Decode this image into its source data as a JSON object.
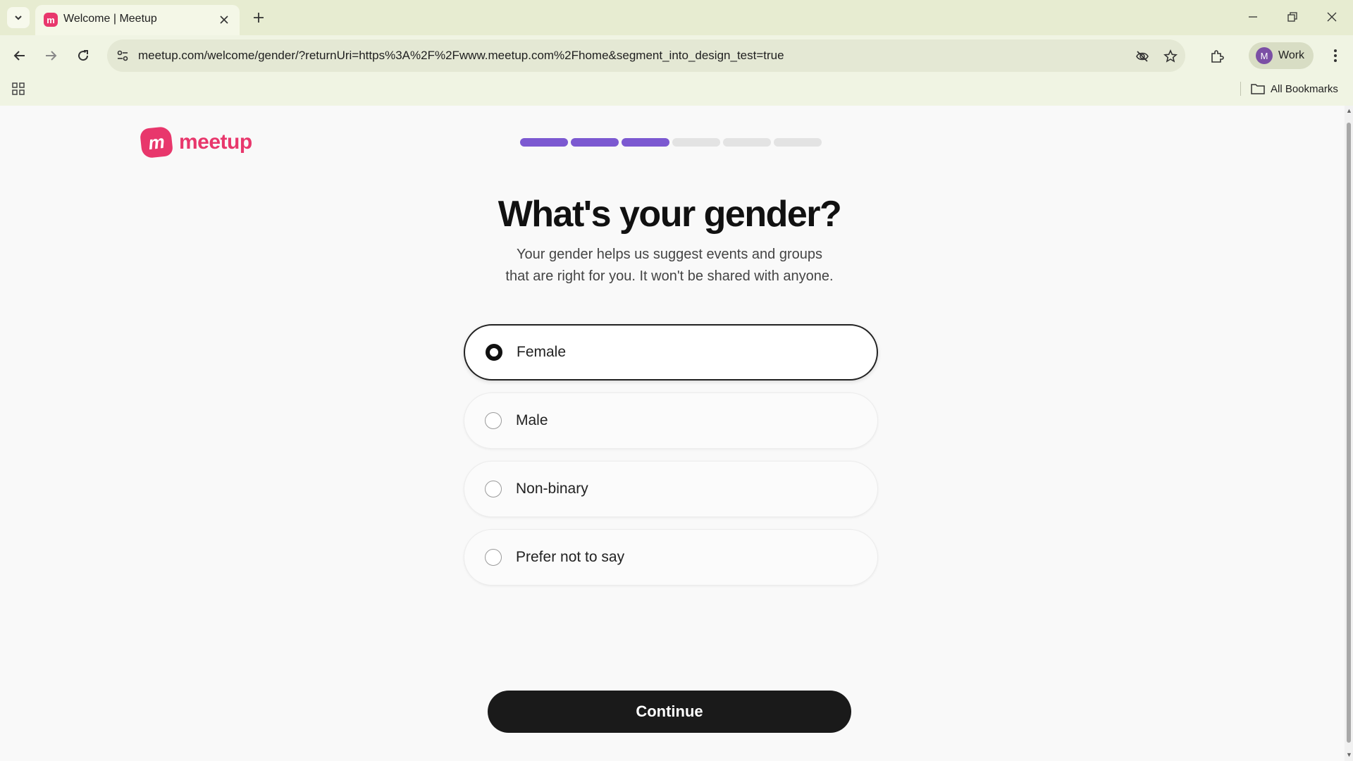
{
  "browser": {
    "tab_title": "Welcome | Meetup",
    "tab_favicon_letter": "m",
    "url": "meetup.com/welcome/gender/?returnUri=https%3A%2F%2Fwww.meetup.com%2Fhome&segment_into_design_test=true",
    "profile_initial": "M",
    "profile_label": "Work",
    "all_bookmarks_label": "All Bookmarks",
    "icons": [
      "chevron-down-icon",
      "close-icon",
      "plus-icon",
      "minimize-icon",
      "restore-icon",
      "back-arrow-icon",
      "forward-arrow-icon",
      "reload-icon",
      "site-info-icon",
      "eye-off-icon",
      "star-icon",
      "puzzle-icon",
      "kebab-icon",
      "apps-grid-icon",
      "folder-icon"
    ]
  },
  "page": {
    "logo_mark": "m",
    "logo_text": "meetup",
    "progress": {
      "total_steps": 6,
      "completed_steps": 3,
      "active_color": "#7c59d1",
      "inactive_color": "#e3e3e3"
    },
    "heading": "What's your gender?",
    "subtext_line1": "Your gender helps us suggest events and groups",
    "subtext_line2": "that are right for you. It won't be shared with anyone.",
    "options": [
      {
        "label": "Female",
        "selected": true
      },
      {
        "label": "Male",
        "selected": false
      },
      {
        "label": "Non-binary",
        "selected": false
      },
      {
        "label": "Prefer not to say",
        "selected": false
      }
    ],
    "continue_label": "Continue"
  },
  "colors": {
    "brand": "#e8376c",
    "button_bg": "#1a1a1a",
    "page_bg": "#f9f9f9",
    "chrome_bg": "#f0f4e3"
  }
}
